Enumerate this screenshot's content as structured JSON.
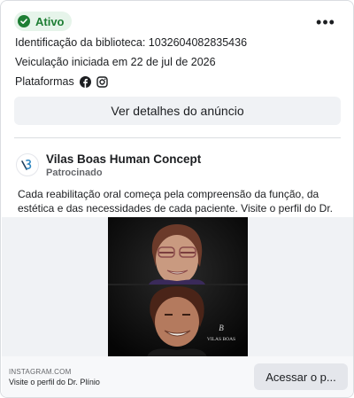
{
  "status": {
    "label": "Ativo",
    "color": "#1e7e34",
    "icon": "check-circle-icon"
  },
  "menu": {
    "icon": "more-options-icon",
    "label": "•••"
  },
  "library_id": "Identificação da biblioteca: 1032604082835436",
  "run_started": "Veiculação iniciada em 22 de jul de 2026",
  "platforms": {
    "label": "Plataformas",
    "icons": [
      "facebook-icon",
      "instagram-icon"
    ]
  },
  "details_button": "Ver detalhes do anúncio",
  "advertiser": {
    "name": "Vilas Boas Human Concept",
    "sponsored": "Patrocinado",
    "logo_icon": "vilas-boas-logo-icon"
  },
  "ad_text": "Cada reabilitação oral começa pela compreensão da função, da estética e das necessidades de cada paciente. Visite o perfil do Dr. Plínio.",
  "media": {
    "watermark": "VILAS BOAS"
  },
  "footer": {
    "domain": "INSTAGRAM.COM",
    "caption": "Visite o perfil do Dr. Plínio",
    "cta": "Acessar o p..."
  }
}
